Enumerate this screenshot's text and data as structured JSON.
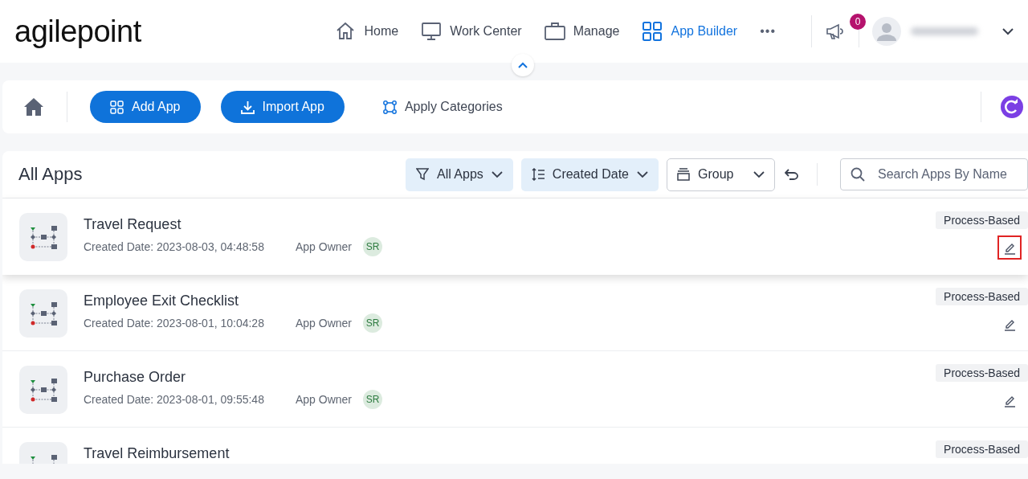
{
  "header": {
    "logo": "agilepoint",
    "nav": [
      {
        "kind": "home",
        "label": "Home",
        "selected": false
      },
      {
        "kind": "monitor",
        "label": "Work Center",
        "selected": false
      },
      {
        "kind": "briefcase",
        "label": "Manage",
        "selected": false
      },
      {
        "kind": "grid",
        "label": "App Builder",
        "selected": true
      }
    ],
    "more": "•••",
    "notifications": "0"
  },
  "toolbar": {
    "buttons": [
      {
        "kind": "add",
        "label": "Add App"
      },
      {
        "kind": "import",
        "label": "Import App"
      }
    ],
    "link": "Apply Categories"
  },
  "list": {
    "title": "All Apps",
    "filters": [
      {
        "kind": "filter",
        "label": "All Apps"
      },
      {
        "kind": "sort",
        "label": "Created Date"
      },
      {
        "kind": "group",
        "label": "Group"
      }
    ],
    "search": {
      "placeholder": "Search Apps By Name"
    },
    "apps": [
      {
        "name": "Travel Request",
        "created": "Created Date: 2023-08-03, 04:48:58",
        "owner_label": "App Owner",
        "owner": "SR",
        "type": "Process-Based",
        "selected": true,
        "highlighted": true
      },
      {
        "name": "Employee Exit Checklist",
        "created": "Created Date: 2023-08-01, 10:04:28",
        "owner_label": "App Owner",
        "owner": "SR",
        "type": "Process-Based",
        "selected": false,
        "highlighted": false
      },
      {
        "name": "Purchase Order",
        "created": "Created Date: 2023-08-01, 09:55:48",
        "owner_label": "App Owner",
        "owner": "SR",
        "type": "Process-Based",
        "selected": false,
        "highlighted": false
      },
      {
        "name": "Travel Reimbursement",
        "type": "Process-Based",
        "selected": false
      }
    ]
  }
}
